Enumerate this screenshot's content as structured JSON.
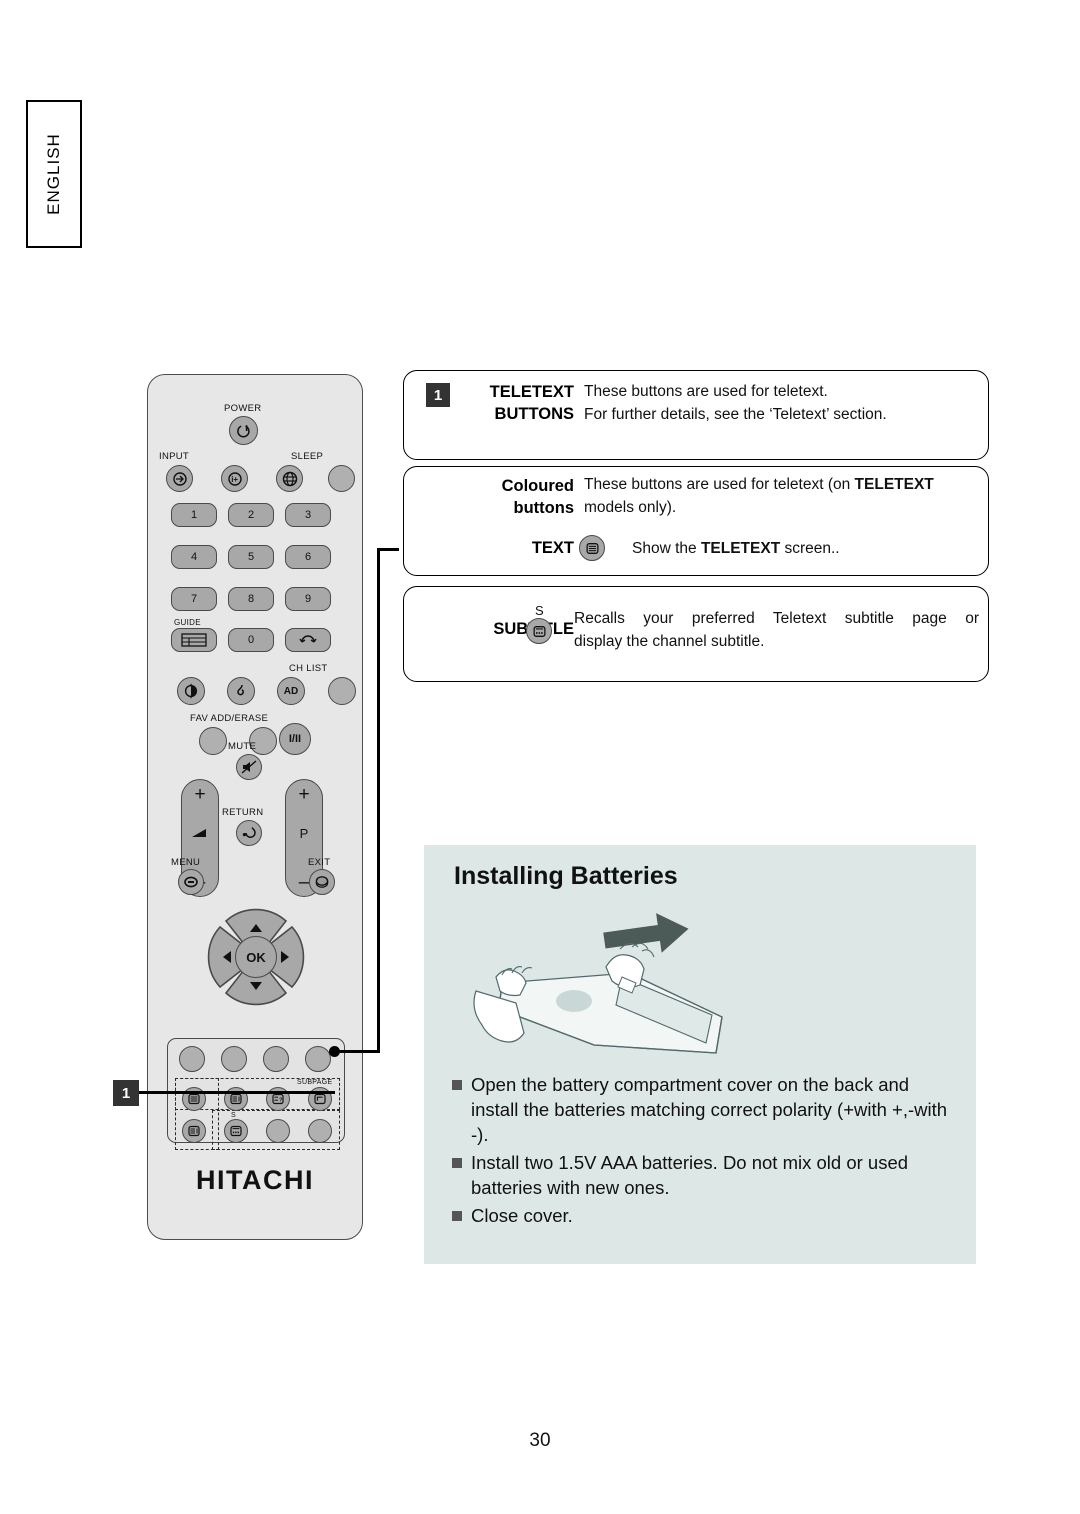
{
  "page": {
    "language_tab": "ENGLISH",
    "page_number": "30"
  },
  "colors": {
    "remote_body": "#e7e7e7",
    "remote_button": "#a8a8a8",
    "battery_panel": "#dde7e6",
    "callout_badge": "#333333",
    "outline": "#000000"
  },
  "remote": {
    "brand": "HITACHI",
    "labels": {
      "power": "POWER",
      "input": "INPUT",
      "sleep": "SLEEP",
      "guide": "GUIDE",
      "ch_list": "CH LIST",
      "fav_add_erase": "FAV ADD/ERASE",
      "mute": "MUTE",
      "return": "RETURN",
      "menu": "MENU",
      "exit": "EXIT",
      "subpage": "SUBPAGE",
      "program": "P",
      "subtitle_s": "S",
      "ok": "OK"
    },
    "keypad": [
      "1",
      "2",
      "3",
      "4",
      "5",
      "6",
      "7",
      "8",
      "9",
      "0"
    ],
    "icons": {
      "power": "power-icon",
      "input_source": "input-source-icon",
      "info": "info-icon",
      "globe": "globe-icon",
      "guide": "guide-grid-icon",
      "recall": "recall-loop-icon",
      "picture": "picture-mode-icon",
      "sound": "sound-mode-icon",
      "audio_description": "AD",
      "freeze": "I/II",
      "mute": "mute-icon",
      "return": "return-arrow-icon",
      "menu": "menu-icon",
      "exit": "exit-icon",
      "volume_up": "plus-icon",
      "volume_down": "minus-icon",
      "teletext": "teletext-icon",
      "subtitle": "subtitle-icon"
    }
  },
  "infoboxes": [
    {
      "badge": "1",
      "term_lines": [
        "TELETEXT",
        "BUTTONS"
      ],
      "desc_lines": [
        "These buttons are used for teletext.",
        "For further details, see the ‘Teletext’ section."
      ]
    },
    {
      "badge": "",
      "rows": [
        {
          "term_lines": [
            "Coloured",
            "buttons"
          ],
          "desc_html": "These buttons are used for teletext (on <b>TELETEXT</b> models only)."
        },
        {
          "term_lines": [
            "TEXT"
          ],
          "icon": "teletext-icon",
          "desc_html": "Show the <b>TELETEXT</b> screen.."
        }
      ]
    },
    {
      "badge": "",
      "term_lines": [
        "SUBTITLE"
      ],
      "icon": "subtitle-icon",
      "icon_label": "S",
      "desc_lines": [
        "Recalls your preferred Teletext subtitle page or",
        "display the channel subtitle."
      ]
    }
  ],
  "battery": {
    "title": "Installing Batteries",
    "bullets": [
      "Open the battery compartment cover on the back and install the batteries matching correct polarity (+with +,-with -).",
      "Install two 1.5V AAA batteries. Do not mix old or used batteries with new ones.",
      "Close cover."
    ],
    "illustration": "hands-opening-remote-battery-cover"
  },
  "callouts": [
    {
      "number": "1",
      "target": "teletext-button-group"
    }
  ]
}
